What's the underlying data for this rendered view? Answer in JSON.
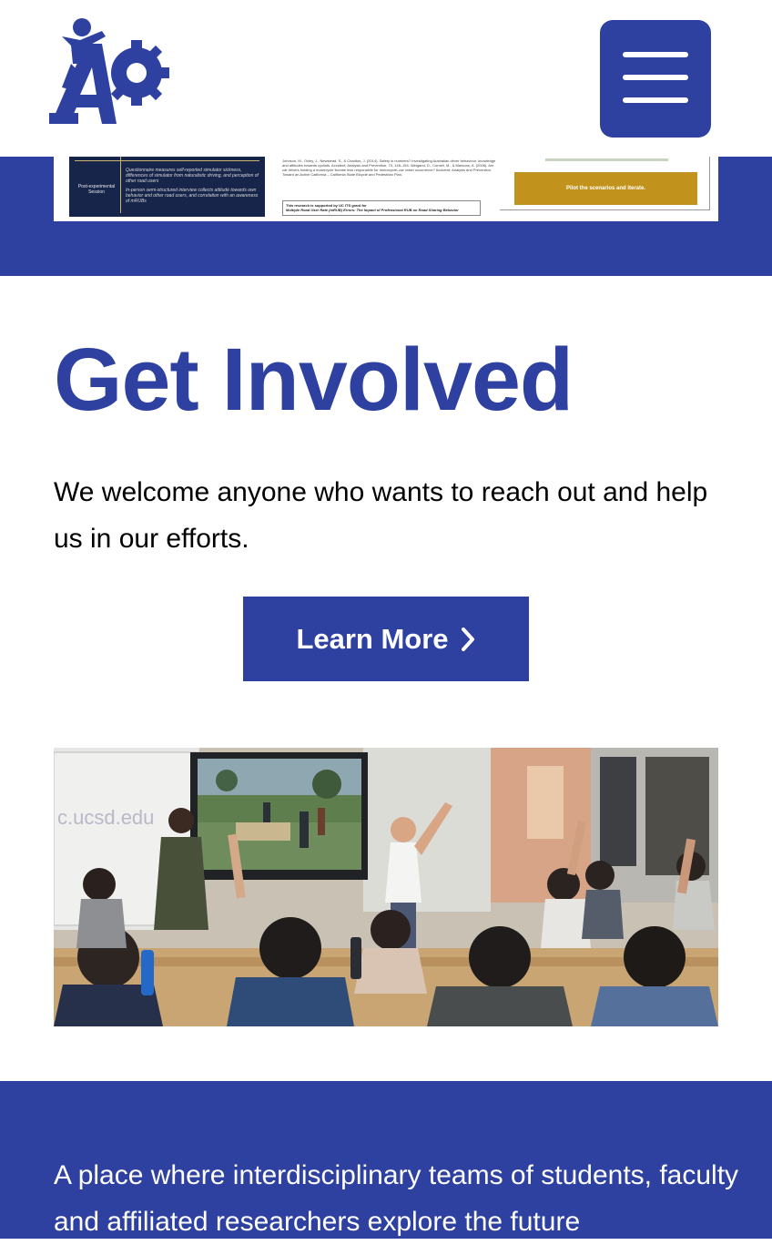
{
  "header": {
    "logo_alt": "AP logo",
    "menu_icon": "hamburger-menu-icon"
  },
  "poster": {
    "session_label": "Post-experimental Session",
    "session_text_1": "Questionnaire measures self-reported simulator sickness, differences of simulator from naturalistic driving, and perception of other road users",
    "session_text_2": "In-person semi-structured interview collects attitude towards own behavior and other road users, and correlation with an awareness of mRUBs",
    "refs": "Johnson, M., Oxley, J., Newstead, S., & Charlton, J. (2014). Safety in numbers? Investigating Australian driver behaviour, knowledge and attitudes towards cyclists. Accident; Analysis and Prevention, 70, 148–154. Weigand, D., Cornell, M., & Marsons, A. (2006). Are car drivers holding a motorcycle license less responsible for motorcycle–car crash occurrence? Accident; Analysis and Prevention. Toward an Active California – California State Bicycle and Pedestrian Plan.",
    "support_line_1": "This research is supported by UC ITS grant for",
    "support_line_2": "Multiple Road User Rate (mRUB) Errors: The Impact of Professional RUB on Road Sharing Behavior",
    "gold_label": "Pilot the scenarios and iterate."
  },
  "get_involved": {
    "title": "Get Involved",
    "intro": "We welcome anyone who wants to reach out and help us in our efforts.",
    "button_label": "Learn More",
    "button_icon": "chevron-right-icon"
  },
  "photo": {
    "whiteboard_text": "c.ucsd.edu"
  },
  "footer_band": {
    "text": "A place where interdisciplinary teams of students, faculty and affiliated researchers explore the future"
  },
  "colors": {
    "brand_blue": "#2e41a1",
    "gold": "#c2931c",
    "poster_navy": "#17254b"
  }
}
